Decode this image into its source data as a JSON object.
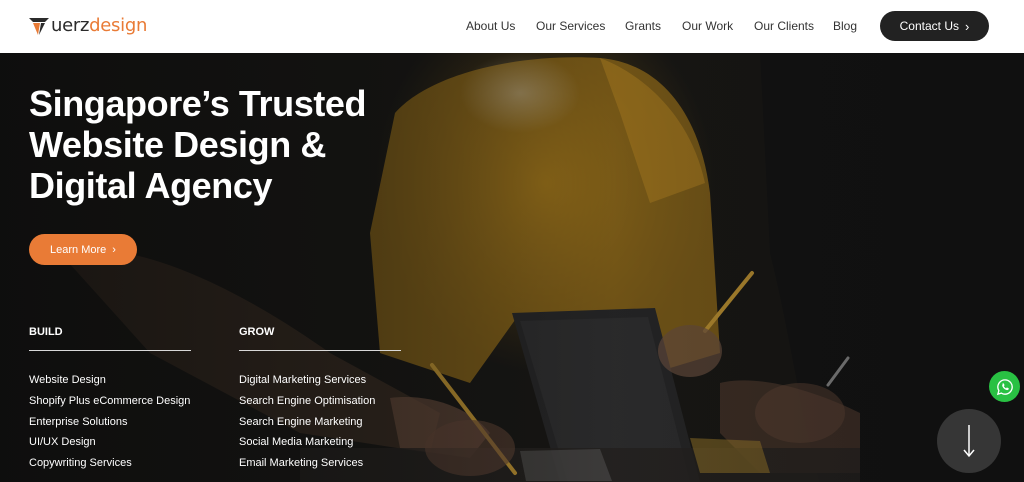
{
  "brand": {
    "logo_text_main": "uerz",
    "logo_text_accent": "design",
    "accent_color": "#e97b36",
    "dark_color": "#222222"
  },
  "nav": {
    "items": [
      {
        "label": "About Us"
      },
      {
        "label": "Our Services"
      },
      {
        "label": "Grants"
      },
      {
        "label": "Our Work"
      },
      {
        "label": "Our Clients"
      },
      {
        "label": "Blog"
      }
    ],
    "contact_label": "Contact Us",
    "contact_icon": "chevron-right-icon"
  },
  "hero": {
    "title_line1": "Singapore’s Trusted",
    "title_line2": "Website Design &",
    "title_line3": "Digital Agency",
    "cta_label": "Learn More",
    "cta_icon": "chevron-right-icon"
  },
  "services": {
    "build": {
      "heading": "BUILD",
      "items": [
        "Website Design",
        "Shopify Plus eCommerce Design",
        "Enterprise Solutions",
        "UI/UX Design",
        "Copywriting Services"
      ]
    },
    "grow": {
      "heading": "GROW",
      "items": [
        "Digital Marketing Services",
        "Search Engine Optimisation",
        "Search Engine Marketing",
        "Social Media Marketing",
        "Email Marketing Services"
      ]
    }
  },
  "floating": {
    "whatsapp_icon": "whatsapp-icon",
    "whatsapp_color": "#29c143",
    "scroll_icon": "arrow-down-icon"
  }
}
